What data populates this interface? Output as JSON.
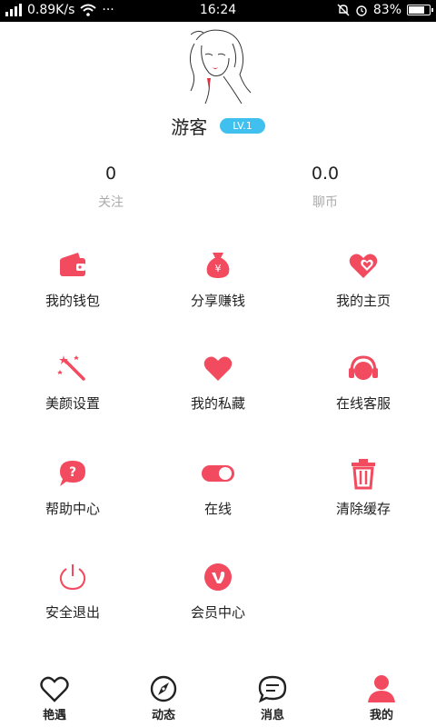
{
  "status_bar": {
    "speed": "0.89K/s",
    "dots": "···",
    "time": "16:24",
    "battery": "83%",
    "battery_fraction": 0.83
  },
  "profile": {
    "name": "游客",
    "level": "LV.1"
  },
  "stats": [
    {
      "value": "0",
      "label": "关注"
    },
    {
      "value": "0.0",
      "label": "聊币"
    }
  ],
  "menu": [
    {
      "label": "我的钱包",
      "icon": "wallet-icon"
    },
    {
      "label": "分享赚钱",
      "icon": "money-bag-icon"
    },
    {
      "label": "我的主页",
      "icon": "hearts-icon"
    },
    {
      "label": "美颜设置",
      "icon": "magic-wand-icon"
    },
    {
      "label": "我的私藏",
      "icon": "heart-icon"
    },
    {
      "label": "在线客服",
      "icon": "headphones-icon"
    },
    {
      "label": "帮助中心",
      "icon": "help-bubble-icon"
    },
    {
      "label": "在线",
      "icon": "toggle-icon"
    },
    {
      "label": "清除缓存",
      "icon": "trash-icon"
    },
    {
      "label": "安全退出",
      "icon": "power-icon"
    },
    {
      "label": "会员中心",
      "icon": "vip-icon"
    }
  ],
  "tabs": [
    {
      "label": "艳遇",
      "icon": "heart-outline-icon"
    },
    {
      "label": "动态",
      "icon": "compass-icon"
    },
    {
      "label": "消息",
      "icon": "chat-icon"
    },
    {
      "label": "我的",
      "icon": "user-icon",
      "active": true
    }
  ],
  "colors": {
    "accent": "#f24a5e",
    "badge": "#3fc0ee",
    "muted": "#aaaaaa"
  }
}
